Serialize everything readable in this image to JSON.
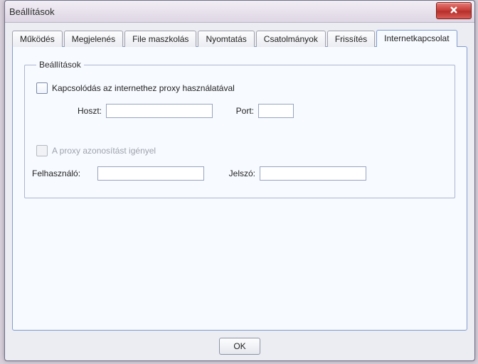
{
  "window": {
    "title": "Beállítások"
  },
  "tabs": [
    {
      "label": "Működés"
    },
    {
      "label": "Megjelenés"
    },
    {
      "label": "File maszkolás"
    },
    {
      "label": "Nyomtatás"
    },
    {
      "label": "Csatolmányok"
    },
    {
      "label": "Frissítés"
    },
    {
      "label": "Internetkapcsolat"
    }
  ],
  "active_tab_index": 6,
  "group": {
    "legend": "Beállítások",
    "use_proxy_label": "Kapcsolódás az internethez proxy használatával",
    "use_proxy_checked": false,
    "host_label": "Hoszt:",
    "host_value": "",
    "port_label": "Port:",
    "port_value": "",
    "auth_label": "A proxy azonosítást igényel",
    "auth_checked": false,
    "auth_enabled": false,
    "user_label": "Felhasználó:",
    "user_value": "",
    "pass_label": "Jelszó:",
    "pass_value": ""
  },
  "buttons": {
    "ok": "OK"
  }
}
